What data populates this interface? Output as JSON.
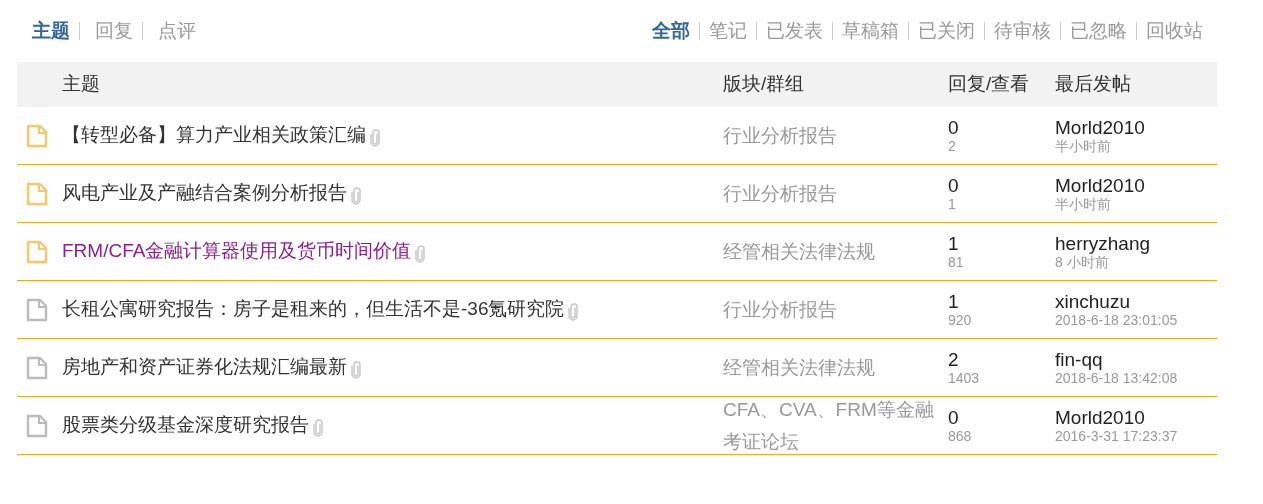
{
  "type_tabs": [
    {
      "label": "主题",
      "selected": true
    },
    {
      "label": "回复",
      "selected": false
    },
    {
      "label": "点评",
      "selected": false
    }
  ],
  "filter_tabs": [
    {
      "label": "全部",
      "selected": true
    },
    {
      "label": "笔记",
      "selected": false
    },
    {
      "label": "已发表",
      "selected": false
    },
    {
      "label": "草稿箱",
      "selected": false
    },
    {
      "label": "已关闭",
      "selected": false
    },
    {
      "label": "待审核",
      "selected": false
    },
    {
      "label": "已忽略",
      "selected": false
    },
    {
      "label": "回收站",
      "selected": false
    }
  ],
  "table": {
    "columns": [
      "主题",
      "版块/群组",
      "回复/查看",
      "最后发帖"
    ],
    "rows": [
      {
        "new": true,
        "visited": false,
        "title": "【转型必备】算力产业相关政策汇编",
        "attachment": true,
        "forum": "行业分析报告",
        "replies": "0",
        "views": "2",
        "last_user": "Morld2010",
        "last_time": "半小时前"
      },
      {
        "new": true,
        "visited": false,
        "title": "风电产业及产融结合案例分析报告",
        "attachment": true,
        "forum": "行业分析报告",
        "replies": "0",
        "views": "1",
        "last_user": "Morld2010",
        "last_time": "半小时前"
      },
      {
        "new": true,
        "visited": true,
        "title": "FRM/CFA金融计算器使用及货币时间价值",
        "attachment": true,
        "forum": "经管相关法律法规",
        "replies": "1",
        "views": "81",
        "last_user": "herryzhang",
        "last_time": "8 小时前"
      },
      {
        "new": false,
        "visited": false,
        "title": "长租公寓研究报告：房子是租来的，但生活不是-36氪研究院",
        "attachment": true,
        "forum": "行业分析报告",
        "replies": "1",
        "views": "920",
        "last_user": "xinchuzu",
        "last_time": "2018-6-18 23:01:05"
      },
      {
        "new": false,
        "visited": false,
        "title": "房地产和资产证券化法规汇编最新",
        "attachment": true,
        "forum": "经管相关法律法规",
        "replies": "2",
        "views": "1403",
        "last_user": "fin-qq",
        "last_time": "2018-6-18 13:42:08"
      },
      {
        "new": false,
        "visited": false,
        "title": "股票类分级基金深度研究报告",
        "attachment": true,
        "forum": "CFA、CVA、FRM等金融考证论坛",
        "replies": "0",
        "views": "868",
        "last_user": "Morld2010",
        "last_time": "2016-3-31 17:23:37"
      }
    ]
  }
}
